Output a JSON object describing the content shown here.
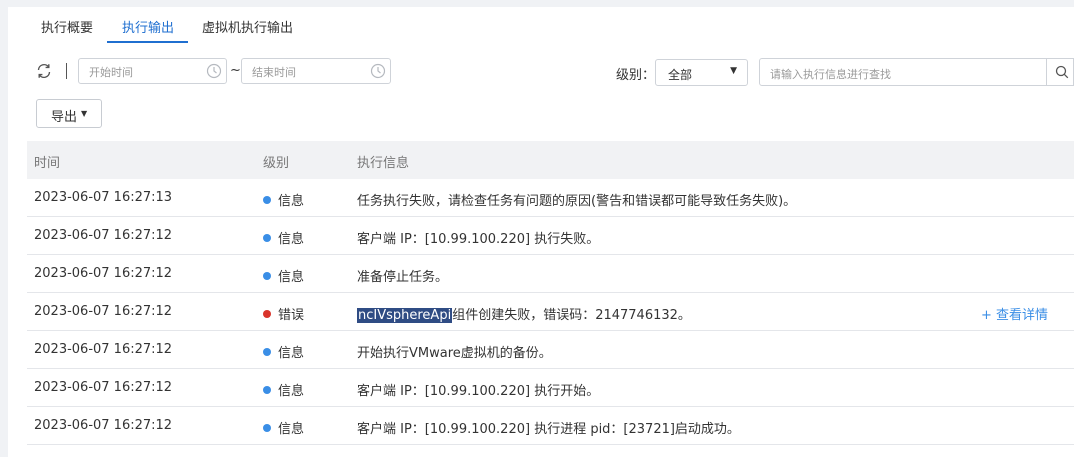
{
  "tabs": [
    {
      "label": "执行概要",
      "active": false
    },
    {
      "label": "执行输出",
      "active": true
    },
    {
      "label": "虚拟机执行输出",
      "active": false
    }
  ],
  "toolbar": {
    "start_placeholder": "开始时间",
    "end_placeholder": "结束时间",
    "range_separator": "~",
    "level_label": "级别：",
    "level_value": "全部",
    "search_placeholder": "请输入执行信息进行查找",
    "export_label": "导出"
  },
  "table": {
    "headers": {
      "time": "时间",
      "level": "级别",
      "message": "执行信息"
    },
    "rows": [
      {
        "time": "2023-06-07 16:27:13",
        "level": "信息",
        "level_color": "#3a8ee6",
        "message": "任务执行失败，请检查任务有问题的原因(警告和错误都可能导致任务失败)。"
      },
      {
        "time": "2023-06-07 16:27:12",
        "level": "信息",
        "level_color": "#3a8ee6",
        "message": "客户端 IP：[10.99.100.220] 执行失败。"
      },
      {
        "time": "2023-06-07 16:27:12",
        "level": "信息",
        "level_color": "#3a8ee6",
        "message": "准备停止任务。"
      },
      {
        "time": "2023-06-07 16:27:12",
        "level": "错误",
        "level_color": "#d9342b",
        "message_highlight": "ncIVsphereApi",
        "message": "组件创建失败，错误码：2147746132。",
        "detail_link": "+ 查看详情"
      },
      {
        "time": "2023-06-07 16:27:12",
        "level": "信息",
        "level_color": "#3a8ee6",
        "message": "开始执行VMware虚拟机的备份。"
      },
      {
        "time": "2023-06-07 16:27:12",
        "level": "信息",
        "level_color": "#3a8ee6",
        "message": "客户端 IP：[10.99.100.220] 执行开始。"
      },
      {
        "time": "2023-06-07 16:27:12",
        "level": "信息",
        "level_color": "#3a8ee6",
        "message": "客户端 IP：[10.99.100.220] 执行进程 pid：[23721]启动成功。"
      }
    ]
  },
  "colors": {
    "accent": "#1f6fd0",
    "info": "#3a8ee6",
    "error": "#d9342b",
    "highlight_bg": "#2f4c84"
  }
}
